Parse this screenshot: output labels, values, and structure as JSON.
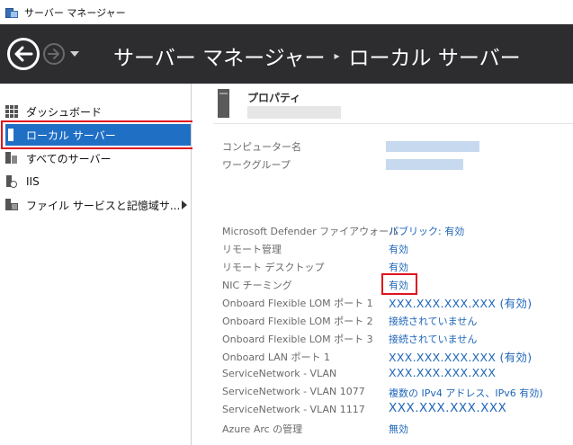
{
  "window": {
    "title": "サーバー マネージャー"
  },
  "header": {
    "breadcrumb_root": "サーバー マネージャー",
    "separator": "▸",
    "breadcrumb_current": "ローカル サーバー"
  },
  "sidebar": {
    "items": [
      {
        "label": "ダッシュボード",
        "icon": "dashboard-icon"
      },
      {
        "label": "ローカル サーバー",
        "icon": "local-server-icon",
        "selected": true
      },
      {
        "label": "すべてのサーバー",
        "icon": "all-servers-icon"
      },
      {
        "label": "IIS",
        "icon": "iis-icon"
      },
      {
        "label": "ファイル サービスと記憶域サ...",
        "icon": "file-services-icon",
        "has_submenu": true
      }
    ]
  },
  "properties": {
    "title": "プロパティ",
    "fields": {
      "computer_name": {
        "label": "コンピューター名"
      },
      "workgroup": {
        "label": "ワークグループ"
      },
      "defender": {
        "label": "Microsoft Defender ファイアウォール",
        "value": "パブリック: 有効"
      },
      "remote_mgmt": {
        "label": "リモート管理",
        "value": "有効"
      },
      "remote_desktop": {
        "label": "リモート デスクトップ",
        "value": "有効"
      },
      "nic_teaming": {
        "label": "NIC チーミング",
        "value": "有効"
      },
      "lom1": {
        "label": "Onboard Flexible LOM ポート 1",
        "value": "XXX.XXX.XXX.XXX (有効)"
      },
      "lom2": {
        "label": "Onboard Flexible LOM ポート 2",
        "value": "接続されていません"
      },
      "lom3": {
        "label": "Onboard Flexible LOM ポート 3",
        "value": "接続されていません"
      },
      "lan1": {
        "label": "Onboard LAN ポート 1",
        "value": "XXX.XXX.XXX.XXX (有効)"
      },
      "svc_vlan": {
        "label": "ServiceNetwork - VLAN",
        "value": "XXX.XXX.XXX.XXX"
      },
      "svc_vlan1077": {
        "label": "ServiceNetwork - VLAN 1077",
        "value": "複数の IPv4 アドレス、IPv6 有効)"
      },
      "svc_vlan1117": {
        "label": "ServiceNetwork - VLAN 1117",
        "value": "XXX.XXX.XXX.XXX"
      },
      "azure_arc": {
        "label": "Azure Arc の管理",
        "value": "無効"
      }
    }
  },
  "colors": {
    "accent": "#1f6fc5",
    "link": "#1f66b8",
    "highlight_box": "#e0141d",
    "header_bg": "#2d2d30"
  }
}
